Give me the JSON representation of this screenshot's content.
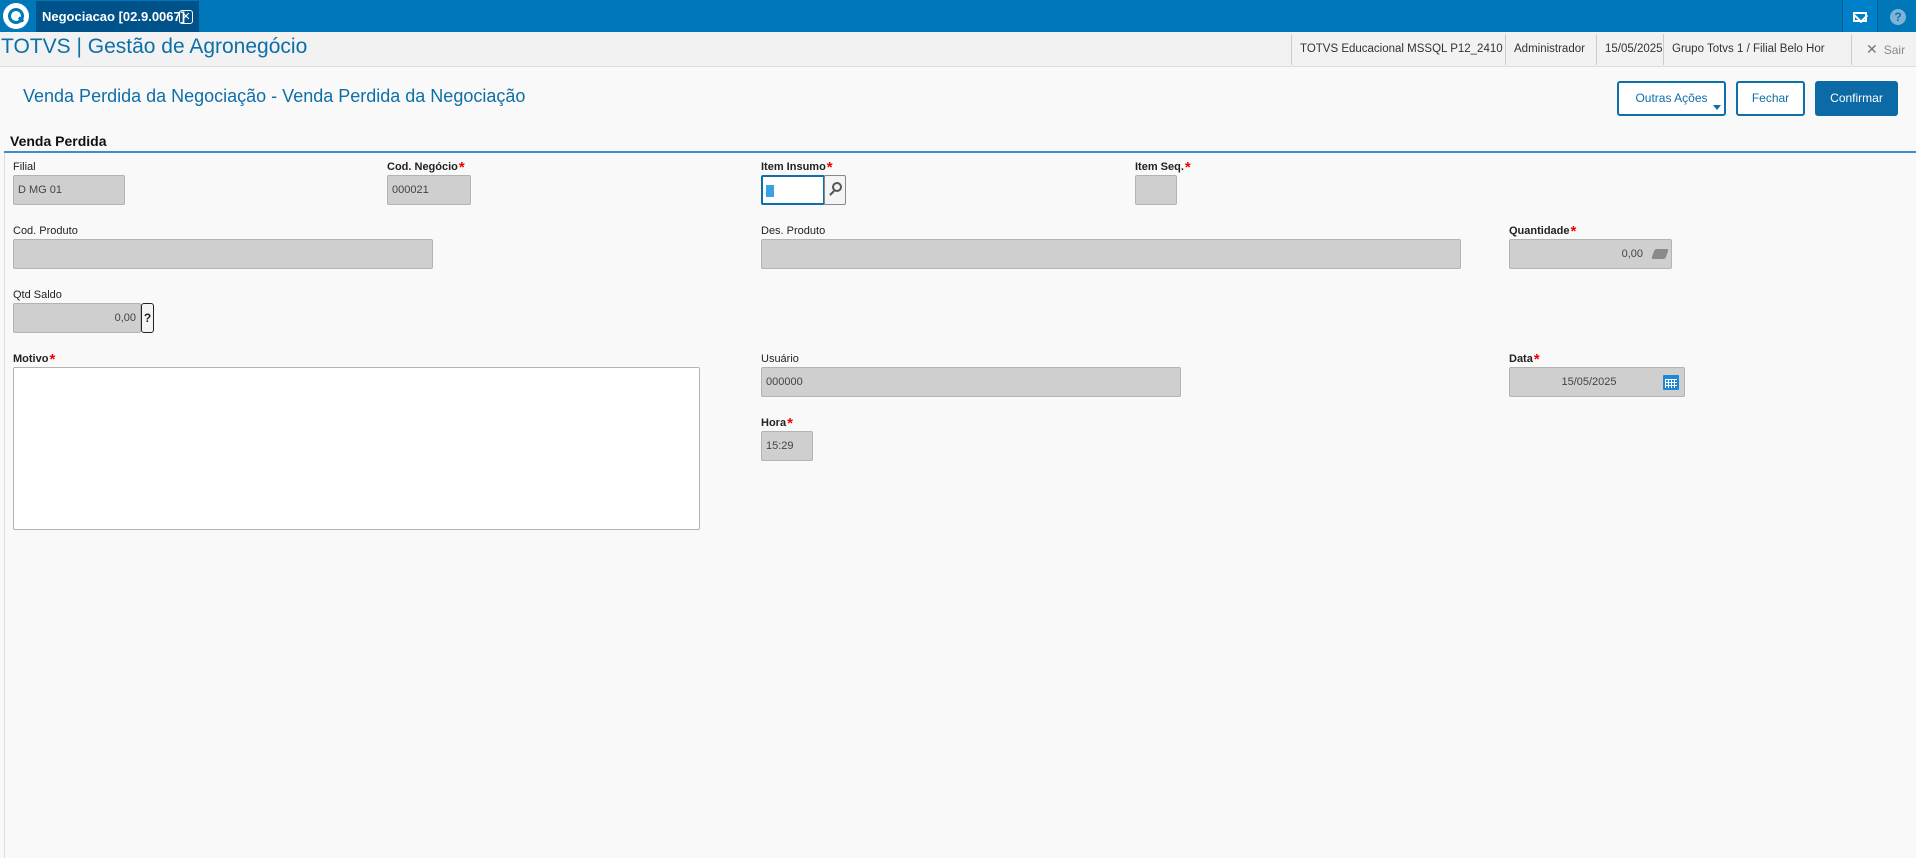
{
  "topbar": {
    "tab_label": "Negociacao [02.9.0067]",
    "tab_close": "✕",
    "help_glyph": "?"
  },
  "header": {
    "app_title": "TOTVS | Gestão de Agronegócio",
    "environment": "TOTVS Educacional MSSQL P12_2410",
    "user": "Administrador",
    "date": "15/05/2025",
    "branch": "Grupo Totvs 1 / Filial Belo Hor",
    "exit_label": "Sair",
    "exit_icon": "✕"
  },
  "page": {
    "title": "Venda Perdida da Negociação - Venda Perdida da Negociação",
    "section_title": "Venda Perdida"
  },
  "actions": {
    "other_actions": "Outras Ações",
    "close": "Fechar",
    "confirm": "Confirmar"
  },
  "fields": {
    "filial": {
      "label": "Filial",
      "value": "D MG 01"
    },
    "cod_negocio": {
      "label": "Cod. Negócio",
      "value": "000021"
    },
    "item_insumo": {
      "label": "Item Insumo",
      "value": ""
    },
    "item_seq": {
      "label": "Item Seq.",
      "value": ""
    },
    "cod_produto": {
      "label": "Cod. Produto",
      "value": ""
    },
    "des_produto": {
      "label": "Des. Produto",
      "value": ""
    },
    "quantidade": {
      "label": "Quantidade",
      "value": "0,00"
    },
    "qtd_saldo": {
      "label": "Qtd Saldo",
      "value": "0,00",
      "help": "?"
    },
    "motivo": {
      "label": "Motivo",
      "value": ""
    },
    "usuario": {
      "label": "Usuário",
      "value": "000000"
    },
    "data": {
      "label": "Data",
      "value": "15/05/2025"
    },
    "hora": {
      "label": "Hora",
      "value": "15:29"
    }
  },
  "required_marker": "*",
  "colors": {
    "topbar": "#0077b9",
    "accent": "#0d6fa8",
    "primary_button": "#0c6aa6",
    "required": "#ee0000",
    "readonly_field": "#cfcfcf"
  }
}
